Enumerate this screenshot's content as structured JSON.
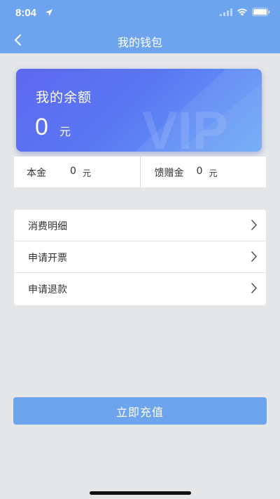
{
  "status_bar": {
    "time": "8:04"
  },
  "nav": {
    "title": "我的钱包"
  },
  "balance_card": {
    "title": "我的余额",
    "amount": "0",
    "unit": "元",
    "watermark": "VIP"
  },
  "funds": {
    "principal": {
      "label": "本金",
      "value": "0",
      "unit": "元"
    },
    "gift": {
      "label": "馈赠金",
      "value": "0",
      "unit": "元"
    }
  },
  "menu": {
    "items": [
      {
        "label": "消费明细"
      },
      {
        "label": "申请开票"
      },
      {
        "label": "申请退款"
      }
    ]
  },
  "actions": {
    "recharge_label": "立即充值"
  },
  "colors": {
    "primary": "#6ea4ee",
    "card_start": "#5d68f0",
    "card_end": "#63a4f7",
    "background": "#e5e6e8"
  }
}
